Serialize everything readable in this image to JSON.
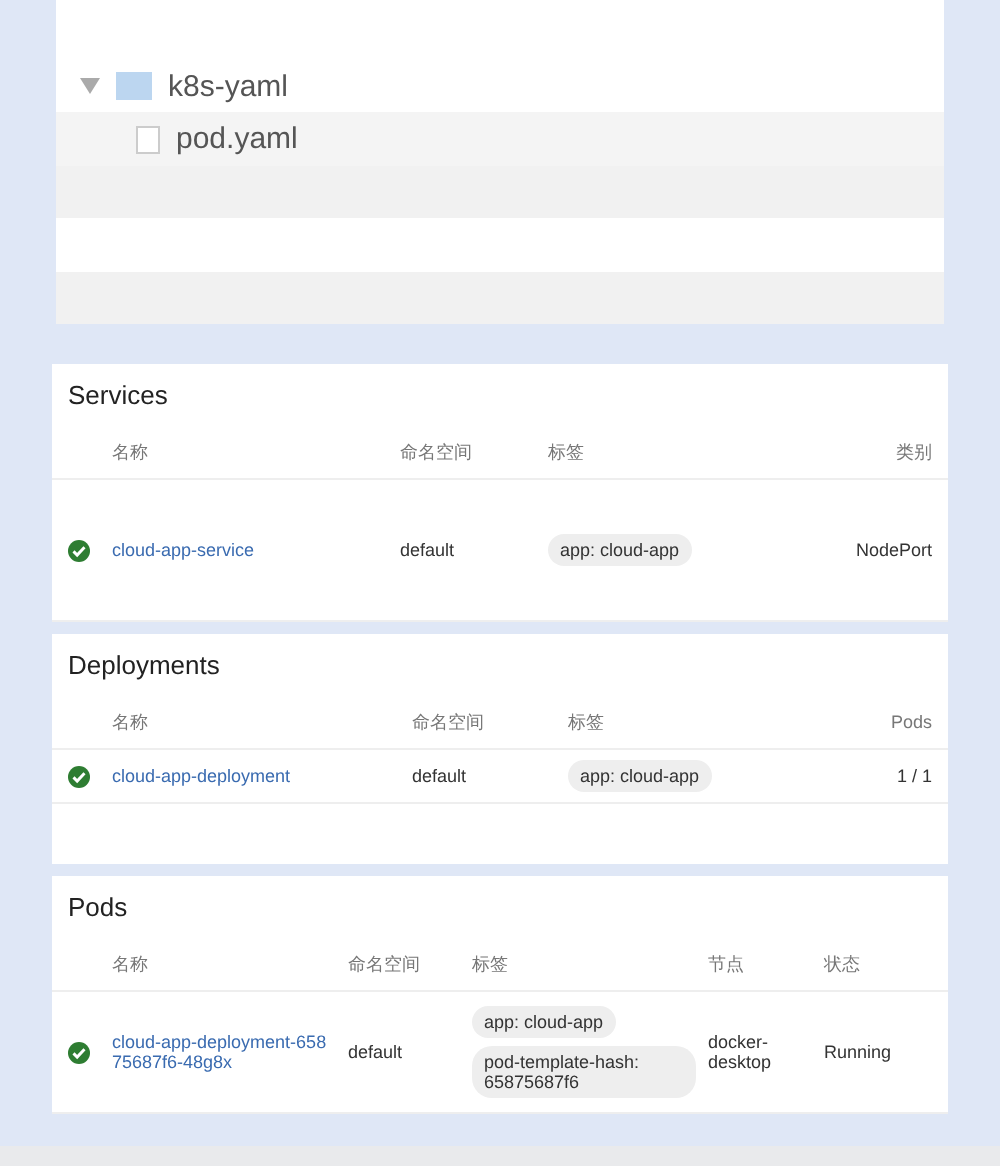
{
  "file_tree": {
    "items": [
      {
        "label": "k8s-yaml",
        "kind": "folder",
        "expanded": true,
        "children": [
          {
            "label": "pod.yaml",
            "kind": "file"
          }
        ]
      }
    ]
  },
  "sections": [
    {
      "title": "Services",
      "columns": [
        "名称",
        "命名空间",
        "标签",
        "类别"
      ],
      "rows": [
        {
          "healthy": true,
          "name": "cloud-app-service",
          "namespace": "default",
          "labels": [
            "app: cloud-app"
          ],
          "extra": [
            "NodePort"
          ]
        }
      ]
    },
    {
      "title": "Deployments",
      "columns": [
        "名称",
        "命名空间",
        "标签",
        "Pods"
      ],
      "rows": [
        {
          "healthy": true,
          "name": "cloud-app-deployment",
          "namespace": "default",
          "labels": [
            "app: cloud-app"
          ],
          "extra": [
            "1 / 1"
          ]
        }
      ]
    },
    {
      "title": "Pods",
      "columns": [
        "名称",
        "命名空间",
        "标签",
        "节点",
        "状态"
      ],
      "rows": [
        {
          "healthy": true,
          "name": "cloud-app-deployment-65875687f6-48g8x",
          "namespace": "default",
          "labels": [
            "app: cloud-app",
            "pod-template-hash: 65875687f6"
          ],
          "extra": [
            "docker-desktop",
            "Running"
          ]
        }
      ]
    }
  ]
}
